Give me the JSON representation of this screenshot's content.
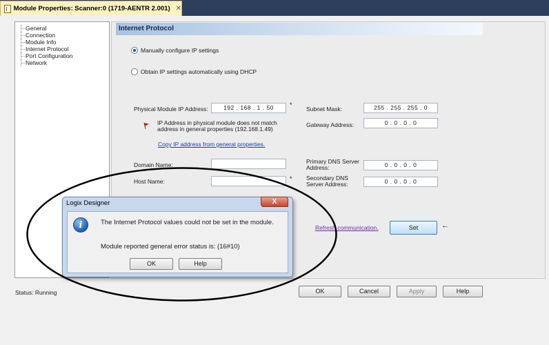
{
  "tab": {
    "title": "Module Properties: Scanner:0 (1719-AENTR 2.001)",
    "close": "✕"
  },
  "tree": {
    "items": [
      "General",
      "Connection",
      "Module Info",
      "Internet Protocol",
      "Port Configuration",
      "Network"
    ]
  },
  "section": {
    "title": "Internet Protocol"
  },
  "ip_mode": {
    "manual_label": "Manually configure IP settings",
    "dhcp_label": "Obtain IP settings automatically using DHCP",
    "selected": "manual"
  },
  "form": {
    "physical_ip_label": "Physical Module IP Address:",
    "physical_ip": "192 . 168 . 1 . 50",
    "asterisk": "*",
    "warning_line1": "IP Address in physical module does not match",
    "warning_line2": "address in general properties (192.168.1.49)",
    "copy_link": "Copy IP address from general properties.",
    "subnet_label": "Subnet Mask:",
    "subnet": "255 . 255 . 255 . 0",
    "gateway_label": "Gateway Address:",
    "gateway": "0 . 0 . 0 . 0",
    "domain_label": "Domain Name:",
    "domain_value": "",
    "host_label": "Host Name:",
    "host_value": "",
    "primary_dns_label_1": "Primary DNS Server",
    "primary_dns_label_2": "Address:",
    "primary_dns": "0 . 0 . 0 . 0",
    "secondary_dns_label_1": "Secondary DNS",
    "secondary_dns_label_2": "Server Address:",
    "secondary_dns": "0 . 0 . 0 . 0",
    "refresh_link": "Refresh communication.",
    "set_button": "Set",
    "set_arrow": "←"
  },
  "footer": {
    "status": "Status:  Running",
    "ok": "OK",
    "cancel": "Cancel",
    "apply": "Apply",
    "help": "Help"
  },
  "dialog": {
    "title": "Logix Designer",
    "close": "X",
    "icon": "i",
    "message": "The Internet Protocol values could not be set in the module.",
    "detail": "Module reported general error status is: (16#10)",
    "ok": "OK",
    "help": "Help"
  },
  "colors": {
    "tab_strip": "#2c3e5c",
    "tab_active": "#fdf1c4",
    "section_header": "#a9c2e0",
    "dialog_frame": "#c7d8ec",
    "set_button": "#bfe0f6",
    "annotation": "#000000"
  },
  "icons": {
    "tab": "module-properties-icon",
    "warning_flag": "red-flag-icon",
    "info": "information-icon",
    "close": "close-icon"
  }
}
